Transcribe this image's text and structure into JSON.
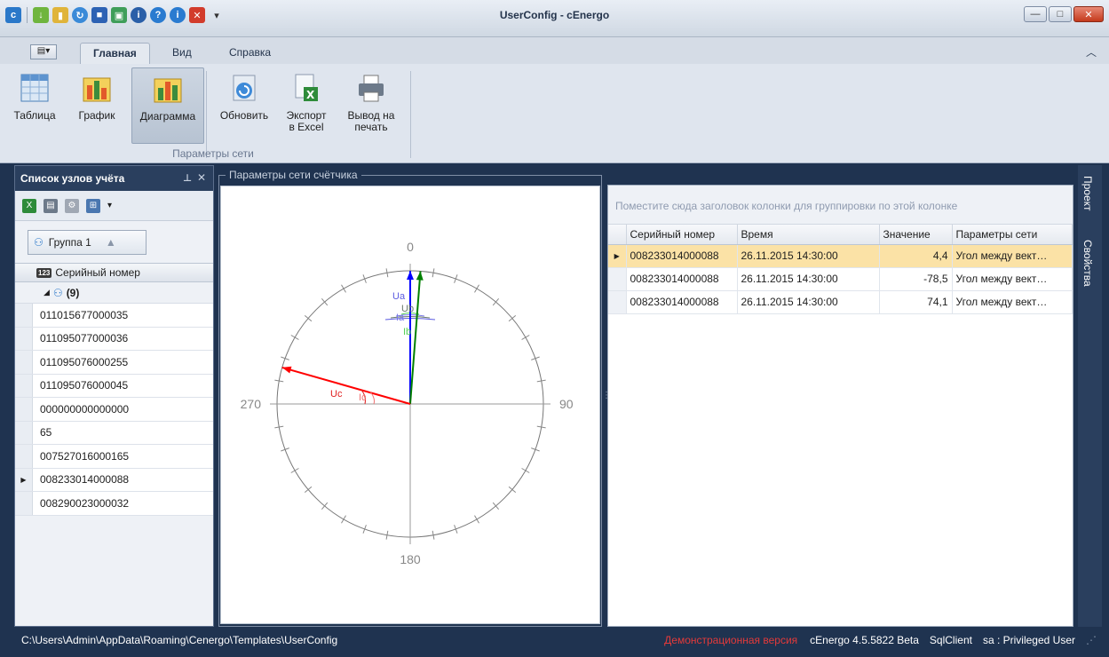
{
  "window": {
    "title": "UserConfig - cEnergo"
  },
  "ribbon_tabs": [
    {
      "label": "Главная",
      "active": true
    },
    {
      "label": "Вид",
      "active": false
    },
    {
      "label": "Справка",
      "active": false
    }
  ],
  "ribbon": {
    "buttons": [
      {
        "label": "Таблица",
        "icon": "table-icon"
      },
      {
        "label": "График",
        "icon": "bar-chart-icon"
      },
      {
        "label": "Диаграмма",
        "icon": "diagram-icon",
        "selected": true
      },
      {
        "label": "Обновить",
        "icon": "refresh-icon"
      },
      {
        "label": "Экспорт в Excel",
        "line1": "Экспорт",
        "line2": "в Excel",
        "icon": "excel-export-icon"
      },
      {
        "label": "Вывод на печать",
        "line1": "Вывод на",
        "line2": "печать",
        "icon": "printer-icon"
      }
    ],
    "group_caption": "Параметры сети"
  },
  "left_panel": {
    "title": "Список узлов учёта",
    "group_chip": "Группа 1",
    "column": "Серийный номер",
    "group_row": "(9)",
    "rows": [
      "011015677000035",
      "011095077000036",
      "011095076000255",
      "011095076000045",
      "000000000000000",
      "65",
      "007527016000165",
      "008233014000088",
      "008290023000032"
    ],
    "selected_index": 7
  },
  "center": {
    "title": "Параметры сети счётчика"
  },
  "chart_data": {
    "type": "polar-vector",
    "angle_labels": [
      "0",
      "90",
      "180",
      "270"
    ],
    "vectors": [
      {
        "name": "Ua",
        "angle_deg": 0,
        "magnitude": 1.0,
        "color": "#0000ff"
      },
      {
        "name": "Ub",
        "angle_deg": 4.4,
        "magnitude": 1.0,
        "color": "#008000"
      },
      {
        "name": "Uc",
        "angle_deg": -74.1,
        "magnitude": 1.0,
        "color": "#ff0000"
      }
    ],
    "arc_labels": [
      {
        "text": "Ua",
        "color": "#5a5ae0"
      },
      {
        "text": "Ub",
        "color": "#6a7a6a"
      },
      {
        "text": "Ia",
        "color": "#7a7ae8"
      },
      {
        "text": "Ib",
        "color": "#55d055"
      },
      {
        "text": "Uc",
        "color": "#e02020"
      },
      {
        "text": "Ic",
        "color": "#f07070"
      }
    ]
  },
  "right_grid": {
    "group_hint": "Поместите сюда заголовок колонки для группировки по этой колонке",
    "columns": [
      "Серийный номер",
      "Время",
      "Значение",
      "Параметры сети"
    ],
    "rows": [
      [
        "008233014000088",
        "26.11.2015 14:30:00",
        "4,4",
        "Угол между вект…"
      ],
      [
        "008233014000088",
        "26.11.2015 14:30:00",
        "-78,5",
        "Угол между вект…"
      ],
      [
        "008233014000088",
        "26.11.2015 14:30:00",
        "74,1",
        "Угол между вект…"
      ]
    ],
    "selected_index": 0
  },
  "right_dock": {
    "tabs": [
      "Проект",
      "Свойства"
    ]
  },
  "status": {
    "path": "C:\\Users\\Admin\\AppData\\Roaming\\Cenergo\\Templates\\UserConfig",
    "demo": "Демонстрационная версия",
    "version": "cEnergo 4.5.5822 Beta",
    "client": "SqlClient",
    "user": "sa : Privileged User"
  }
}
